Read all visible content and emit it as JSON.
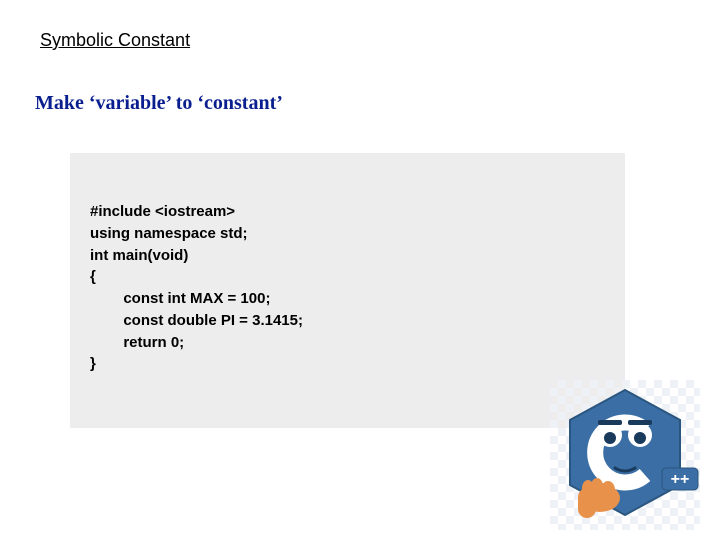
{
  "title": "Symbolic Constant",
  "subtitle": "Make ‘variable’ to ‘constant’",
  "code": "#include <iostream>\nusing namespace std;\nint main(void)\n{\n        const int MAX = 100;\n        const double PI = 3.1415;\n        return 0;\n}",
  "mascot_label": "++"
}
